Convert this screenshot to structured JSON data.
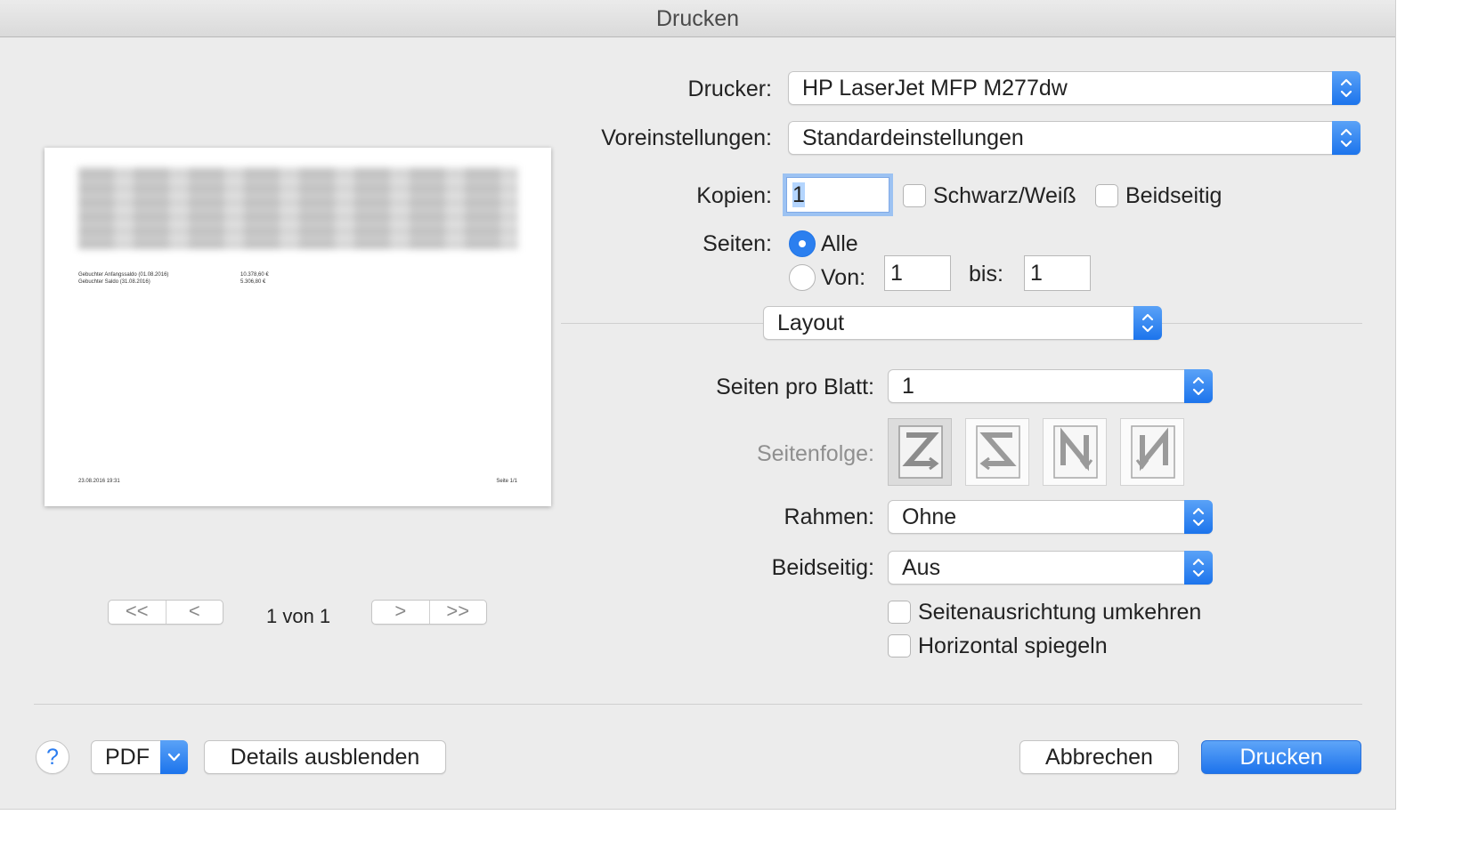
{
  "window": {
    "title": "Drucken"
  },
  "printer": {
    "label": "Drucker:",
    "value": "HP LaserJet MFP M277dw"
  },
  "presets": {
    "label": "Voreinstellungen:",
    "value": "Standardeinstellungen"
  },
  "copies": {
    "label": "Kopien:",
    "value": "1",
    "bw_label": "Schwarz/Weiß",
    "duplex_label": "Beidseitig"
  },
  "pages": {
    "label": "Seiten:",
    "all_label": "Alle",
    "from_label": "Von:",
    "from_value": "1",
    "to_label": "bis:",
    "to_value": "1",
    "selected": "all"
  },
  "section": {
    "value": "Layout"
  },
  "layout": {
    "pages_per_sheet_label": "Seiten pro Blatt:",
    "pages_per_sheet_value": "1",
    "page_order_label": "Seitenfolge:",
    "border_label": "Rahmen:",
    "border_value": "Ohne",
    "two_sided_label": "Beidseitig:",
    "two_sided_value": "Aus",
    "reverse_label": "Seitenausrichtung umkehren",
    "flip_label": "Horizontal spiegeln"
  },
  "preview": {
    "line1_label": "Gebuchter Anfangssaldo (01.08.2016)",
    "line1_value": "10.378,60 €",
    "line2_label": "Gebuchter Saldo (31.08.2016)",
    "line2_value": "5.306,80 €",
    "footer_left": "23.08.2016 19:31",
    "footer_right": "Seite 1/1",
    "page_indicator": "1 von 1",
    "nav_first": "<<",
    "nav_prev": "<",
    "nav_next": ">",
    "nav_last": ">>"
  },
  "footer": {
    "help": "?",
    "pdf": "PDF",
    "details": "Details ausblenden",
    "cancel": "Abbrechen",
    "print": "Drucken"
  },
  "colors": {
    "accent": "#1d73ec",
    "window_bg": "#ececec"
  },
  "icons": [
    "updown-chevron-icon",
    "chevron-down-icon",
    "z-order-icon",
    "reverse-z-order-icon",
    "n-order-icon",
    "reverse-n-order-icon",
    "help-icon"
  ]
}
